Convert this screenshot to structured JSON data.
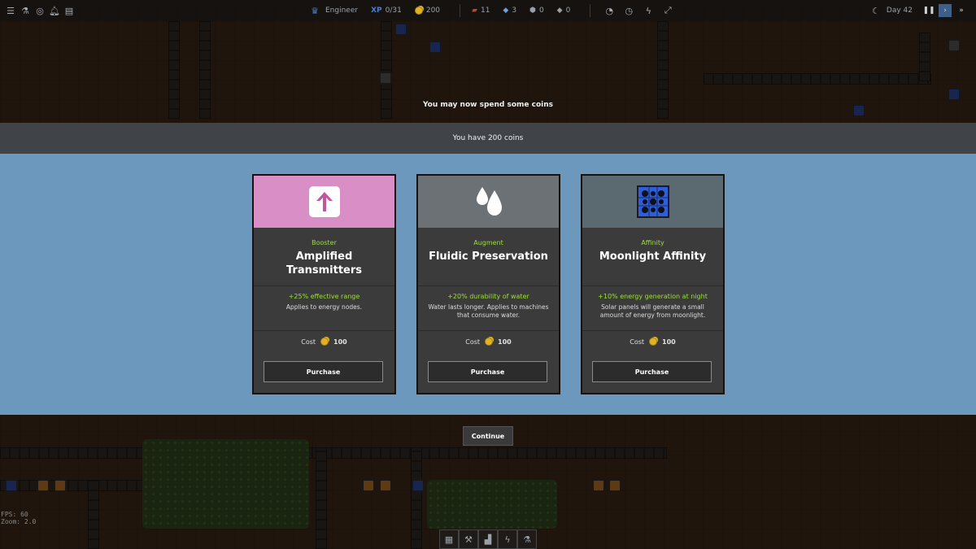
{
  "hud": {
    "role": "Engineer",
    "xp": "0/31",
    "coins": "200",
    "res1": "11",
    "res2": "3",
    "res3": "0",
    "res4": "0",
    "day": "Day 42"
  },
  "modal": {
    "title": "You may now spend some coins",
    "coins_line": "You have 200 coins",
    "continue_label": "Continue",
    "cards": [
      {
        "category": "Booster",
        "name": "Amplified Transmitters",
        "effect": "+25% effective range",
        "description": "Applies to energy nodes.",
        "cost_label": "Cost",
        "cost": "100",
        "button": "Purchase",
        "head_color": "#d98fc6",
        "icon": "arrow-up-icon"
      },
      {
        "category": "Augment",
        "name": "Fluidic Preservation",
        "effect": "+20% durability of water",
        "description": "Water lasts longer. Applies to machines that consume water.",
        "cost_label": "Cost",
        "cost": "100",
        "button": "Purchase",
        "head_color": "#6c7176",
        "icon": "water-drops-icon"
      },
      {
        "category": "Affinity",
        "name": "Moonlight Affinity",
        "effect": "+10% energy generation at night",
        "description": "Solar panels will generate a small amount of energy from moonlight.",
        "cost_label": "Cost",
        "cost": "100",
        "button": "Purchase",
        "head_color": "#5b6a70",
        "icon": "solar-panel-icon"
      }
    ]
  },
  "debug": {
    "fps": "FPS: 60",
    "zoom": "Zoom: 2.0"
  },
  "colors": {
    "accent_green": "#9adf3c",
    "panel_blue": "#6d98bd"
  }
}
